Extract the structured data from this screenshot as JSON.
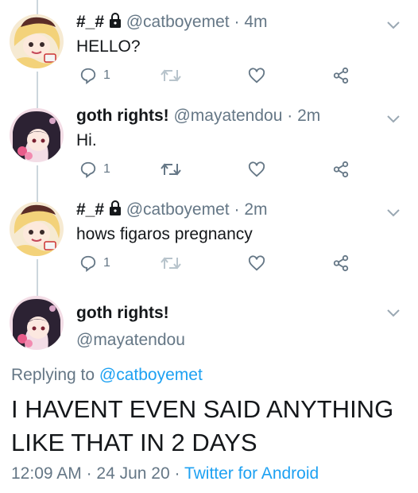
{
  "tweets": [
    {
      "name": "#_#",
      "handle": "@catboyemet",
      "sep": "·",
      "time": "4m",
      "text": "HELLO?",
      "reply_count": "1"
    },
    {
      "name": "goth rights!",
      "handle": "@mayatendou",
      "sep": "·",
      "time": "2m",
      "text": "Hi.",
      "reply_count": "1"
    },
    {
      "name": "#_#",
      "handle": "@catboyemet",
      "sep": "·",
      "time": "2m",
      "text": "hows figaros pregnancy",
      "reply_count": "1"
    }
  ],
  "focus": {
    "name": "goth rights!",
    "handle": "@mayatendou",
    "replying_prefix": "Replying to ",
    "replying_handle": "@catboyemet",
    "text": "I HAVENT EVEN SAID ANYTHING LIKE THAT IN 2 DAYS",
    "time": "12:09 AM",
    "sep1": " · ",
    "date": "24 Jun 20",
    "sep2": " · ",
    "client": "Twitter for Android"
  },
  "colors": {
    "accent": "#1da1f2",
    "secondary_text": "#657786",
    "thread_line": "#ccd6dd"
  },
  "icons": [
    "lock-icon",
    "reply-icon",
    "retweet-icon",
    "like-icon",
    "share-icon",
    "chevron-down-icon"
  ]
}
